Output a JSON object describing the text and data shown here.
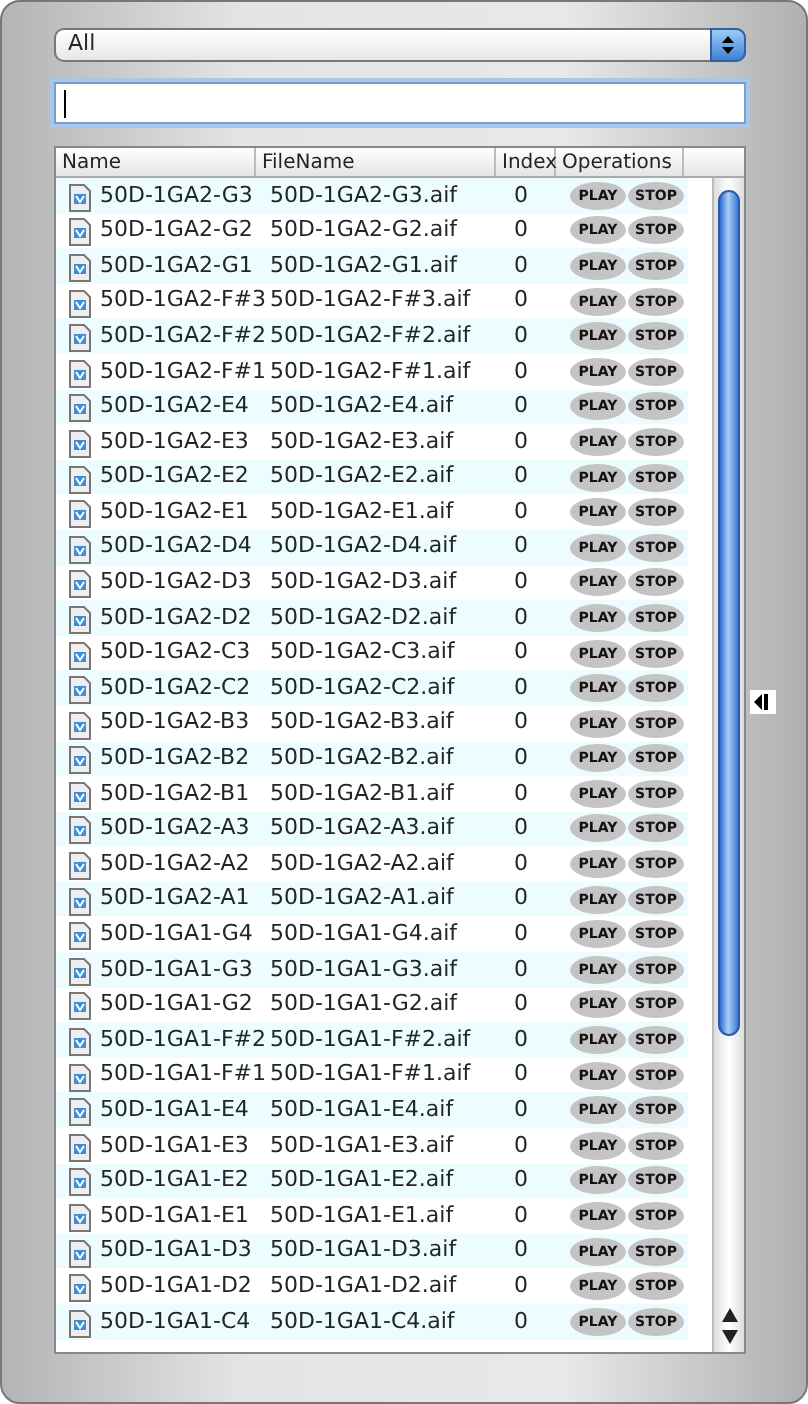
{
  "filter_select": {
    "value": "All"
  },
  "search_field": {
    "focused": true
  },
  "table": {
    "columns": [
      "Name",
      "FileName",
      "Index",
      "Operations"
    ],
    "rows": [
      {
        "name": "50D-1GA2-G3",
        "file": "50D-1GA2-G3.aif",
        "index": "0",
        "ops": [
          "PLAY",
          "STOP"
        ]
      },
      {
        "name": "50D-1GA2-G2",
        "file": "50D-1GA2-G2.aif",
        "index": "0",
        "ops": [
          "PLAY",
          "STOP"
        ]
      },
      {
        "name": "50D-1GA2-G1",
        "file": "50D-1GA2-G1.aif",
        "index": "0",
        "ops": [
          "PLAY",
          "STOP"
        ]
      },
      {
        "name": "50D-1GA2-F#3",
        "file": "50D-1GA2-F#3.aif",
        "index": "0",
        "ops": [
          "PLAY",
          "STOP"
        ]
      },
      {
        "name": "50D-1GA2-F#2",
        "file": "50D-1GA2-F#2.aif",
        "index": "0",
        "ops": [
          "PLAY",
          "STOP"
        ]
      },
      {
        "name": "50D-1GA2-F#1",
        "file": "50D-1GA2-F#1.aif",
        "index": "0",
        "ops": [
          "PLAY",
          "STOP"
        ]
      },
      {
        "name": "50D-1GA2-E4",
        "file": "50D-1GA2-E4.aif",
        "index": "0",
        "ops": [
          "PLAY",
          "STOP"
        ]
      },
      {
        "name": "50D-1GA2-E3",
        "file": "50D-1GA2-E3.aif",
        "index": "0",
        "ops": [
          "PLAY",
          "STOP"
        ]
      },
      {
        "name": "50D-1GA2-E2",
        "file": "50D-1GA2-E2.aif",
        "index": "0",
        "ops": [
          "PLAY",
          "STOP"
        ]
      },
      {
        "name": "50D-1GA2-E1",
        "file": "50D-1GA2-E1.aif",
        "index": "0",
        "ops": [
          "PLAY",
          "STOP"
        ]
      },
      {
        "name": "50D-1GA2-D4",
        "file": "50D-1GA2-D4.aif",
        "index": "0",
        "ops": [
          "PLAY",
          "STOP"
        ]
      },
      {
        "name": "50D-1GA2-D3",
        "file": "50D-1GA2-D3.aif",
        "index": "0",
        "ops": [
          "PLAY",
          "STOP"
        ]
      },
      {
        "name": "50D-1GA2-D2",
        "file": "50D-1GA2-D2.aif",
        "index": "0",
        "ops": [
          "PLAY",
          "STOP"
        ]
      },
      {
        "name": "50D-1GA2-C3",
        "file": "50D-1GA2-C3.aif",
        "index": "0",
        "ops": [
          "PLAY",
          "STOP"
        ]
      },
      {
        "name": "50D-1GA2-C2",
        "file": "50D-1GA2-C2.aif",
        "index": "0",
        "ops": [
          "PLAY",
          "STOP"
        ]
      },
      {
        "name": "50D-1GA2-B3",
        "file": "50D-1GA2-B3.aif",
        "index": "0",
        "ops": [
          "PLAY",
          "STOP"
        ]
      },
      {
        "name": "50D-1GA2-B2",
        "file": "50D-1GA2-B2.aif",
        "index": "0",
        "ops": [
          "PLAY",
          "STOP"
        ]
      },
      {
        "name": "50D-1GA2-B1",
        "file": "50D-1GA2-B1.aif",
        "index": "0",
        "ops": [
          "PLAY",
          "STOP"
        ]
      },
      {
        "name": "50D-1GA2-A3",
        "file": "50D-1GA2-A3.aif",
        "index": "0",
        "ops": [
          "PLAY",
          "STOP"
        ]
      },
      {
        "name": "50D-1GA2-A2",
        "file": "50D-1GA2-A2.aif",
        "index": "0",
        "ops": [
          "PLAY",
          "STOP"
        ]
      },
      {
        "name": "50D-1GA2-A1",
        "file": "50D-1GA2-A1.aif",
        "index": "0",
        "ops": [
          "PLAY",
          "STOP"
        ]
      },
      {
        "name": "50D-1GA1-G4",
        "file": "50D-1GA1-G4.aif",
        "index": "0",
        "ops": [
          "PLAY",
          "STOP"
        ]
      },
      {
        "name": "50D-1GA1-G3",
        "file": "50D-1GA1-G3.aif",
        "index": "0",
        "ops": [
          "PLAY",
          "STOP"
        ]
      },
      {
        "name": "50D-1GA1-G2",
        "file": "50D-1GA1-G2.aif",
        "index": "0",
        "ops": [
          "PLAY",
          "STOP"
        ]
      },
      {
        "name": "50D-1GA1-F#2",
        "file": "50D-1GA1-F#2.aif",
        "index": "0",
        "ops": [
          "PLAY",
          "STOP"
        ]
      },
      {
        "name": "50D-1GA1-F#1",
        "file": "50D-1GA1-F#1.aif",
        "index": "0",
        "ops": [
          "PLAY",
          "STOP"
        ]
      },
      {
        "name": "50D-1GA1-E4",
        "file": "50D-1GA1-E4.aif",
        "index": "0",
        "ops": [
          "PLAY",
          "STOP"
        ]
      },
      {
        "name": "50D-1GA1-E3",
        "file": "50D-1GA1-E3.aif",
        "index": "0",
        "ops": [
          "PLAY",
          "STOP"
        ]
      },
      {
        "name": "50D-1GA1-E2",
        "file": "50D-1GA1-E2.aif",
        "index": "0",
        "ops": [
          "PLAY",
          "STOP"
        ]
      },
      {
        "name": "50D-1GA1-E1",
        "file": "50D-1GA1-E1.aif",
        "index": "0",
        "ops": [
          "PLAY",
          "STOP"
        ]
      },
      {
        "name": "50D-1GA1-D3",
        "file": "50D-1GA1-D3.aif",
        "index": "0",
        "ops": [
          "PLAY",
          "STOP"
        ]
      },
      {
        "name": "50D-1GA1-D2",
        "file": "50D-1GA1-D2.aif",
        "index": "0",
        "ops": [
          "PLAY",
          "STOP"
        ]
      },
      {
        "name": "50D-1GA1-C4",
        "file": "50D-1GA1-C4.aif",
        "index": "0",
        "ops": [
          "PLAY",
          "STOP"
        ]
      }
    ]
  }
}
